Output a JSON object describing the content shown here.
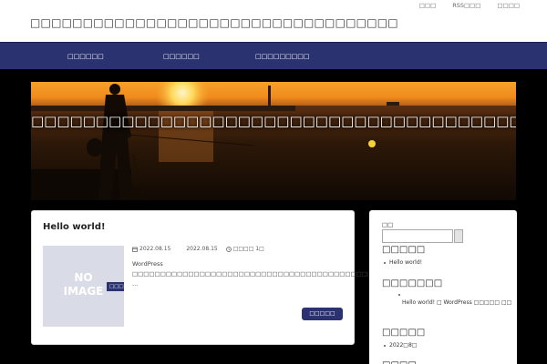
{
  "header": {
    "site_title": "□□□□□□□□□□□□□□□□□□□□□□□□□□□□□□□□□□□",
    "util_nav": [
      "□□□",
      "RSS□□□",
      "□□□□"
    ]
  },
  "nav": {
    "items": [
      "□□□□□□",
      "□□□□□□",
      "□□□□□□□□□"
    ]
  },
  "hero": {
    "text": "□□□□□□□□□□□□□□□□□□□□□□□□□□□□□□□□□□□□□□□□□□□□□□□□□□□□□□□□□□"
  },
  "post": {
    "title": "Hello world!",
    "category": "□□□",
    "thumb_text_1": "NO",
    "thumb_text_2": "IMAGE",
    "published": "2022.08.15",
    "updated": "2022.08.15",
    "comments": "□□□□ 1□",
    "excerpt": "WordPress □□□□□□□□□□□□□□□□□□□□□□□□□□□□□□□□□□□□□□□□□□□□□□□□",
    "excerpt_more": "...",
    "more_label": "□□□□□"
  },
  "sidebar": {
    "search_label": "□□",
    "recent_posts_heading": "□□□□□",
    "recent_posts": [
      "Hello world!"
    ],
    "recent_comments_heading": "□□□□□□□",
    "recent_comment": "Hello world! □ WordPress □□□□□ □□",
    "archives_heading": "□□□□□",
    "archives": [
      "2022□8□"
    ]
  }
}
